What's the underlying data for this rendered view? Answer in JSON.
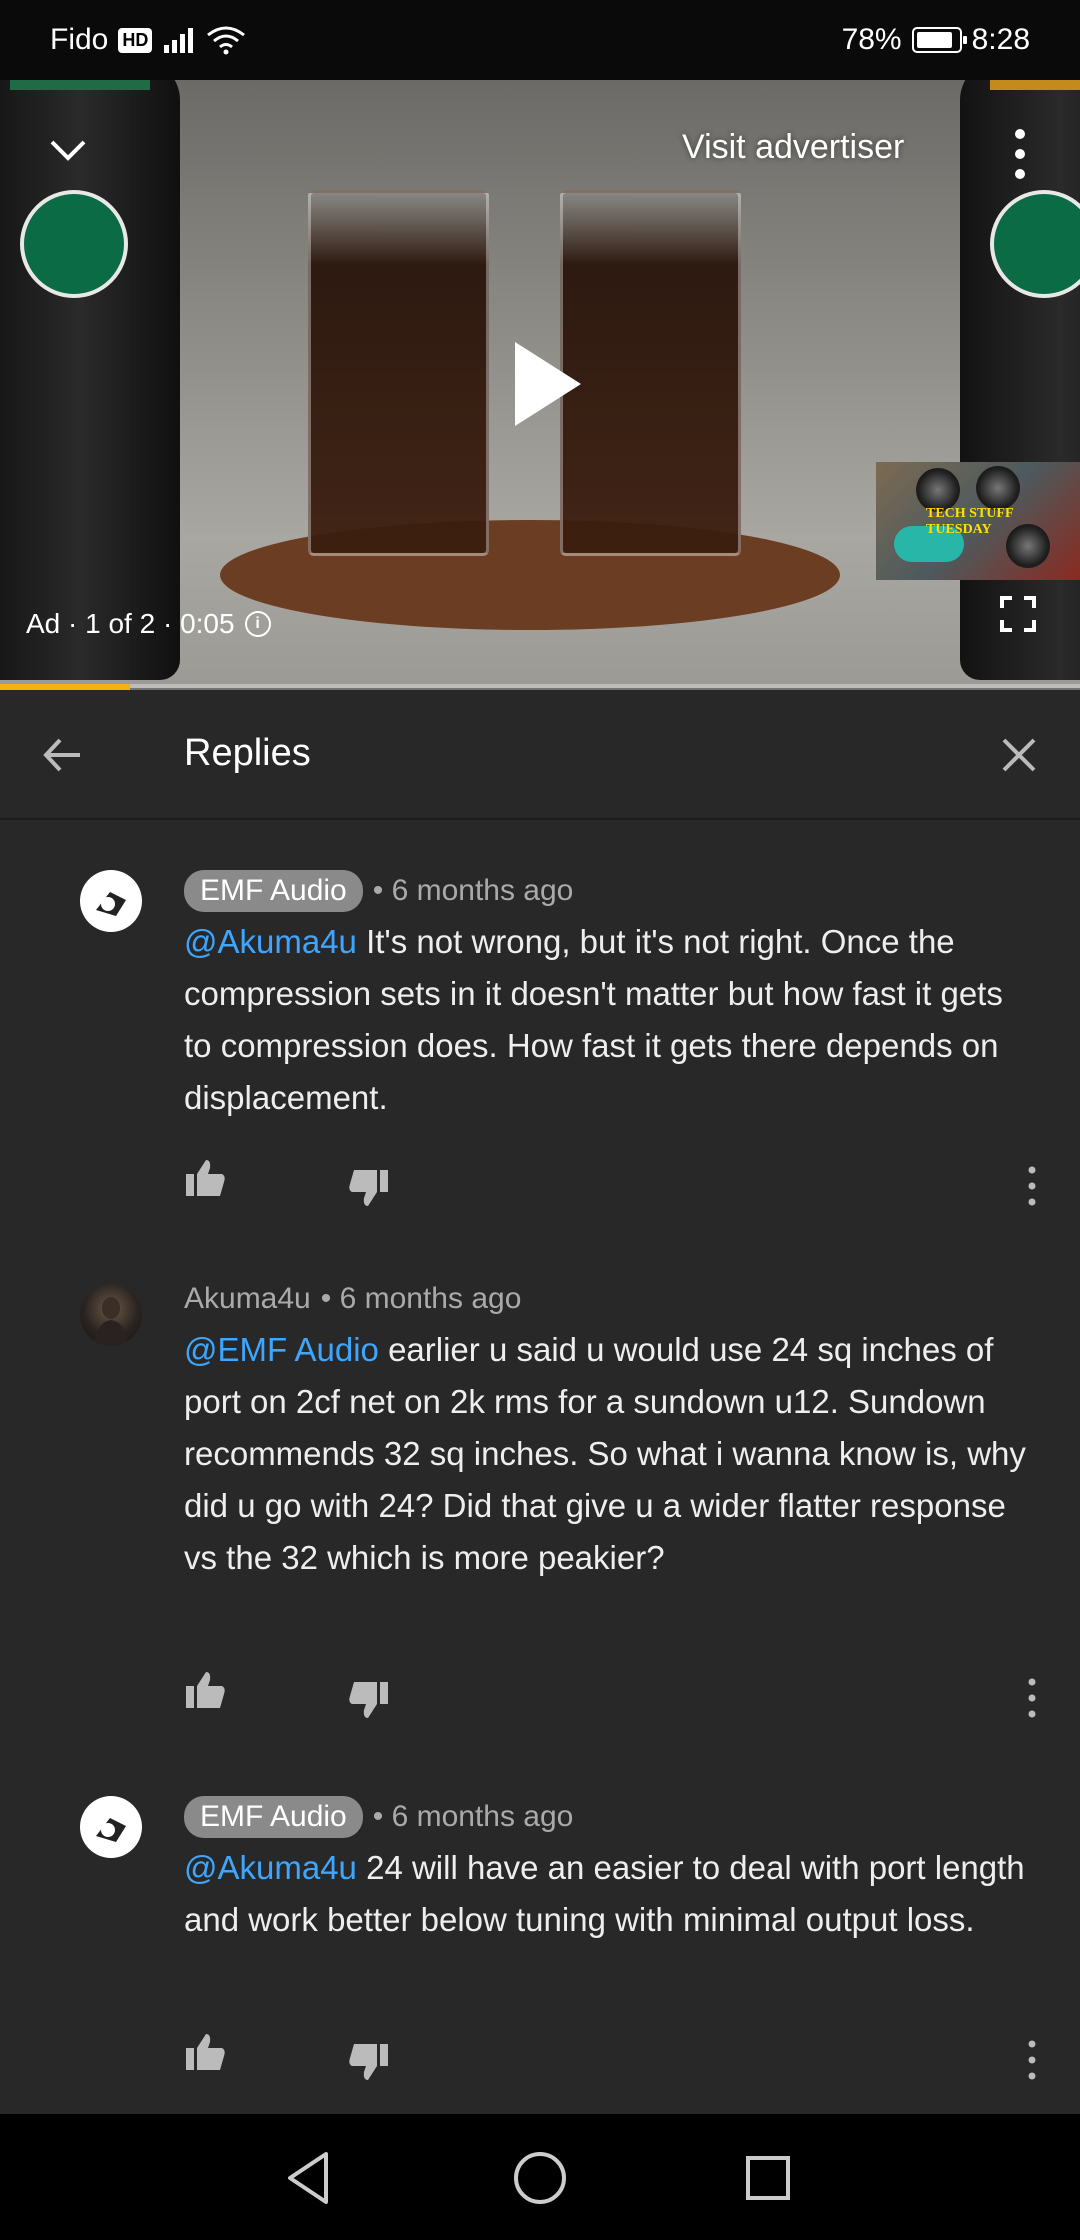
{
  "status_bar": {
    "carrier": "Fido",
    "hd_badge": "HD",
    "battery": "78%",
    "time": "8:28"
  },
  "video": {
    "visit_advertiser": "Visit advertiser",
    "ad_info": "Ad · 1 of 2 · 0:05",
    "info_icon": "ⓘ",
    "progress": 0.12,
    "thumbnail_text": "TECH STUFF TUESDAY"
  },
  "replies_header": {
    "title": "Replies"
  },
  "comments": [
    {
      "author": "EMF Audio",
      "is_creator": true,
      "time": "• 6 months ago",
      "mention": "@Akuma4u",
      "text": " It's not wrong, but it's not right. Once the compression sets in it doesn't matter but how fast it gets to compression does. How fast it gets there depends on displacement."
    },
    {
      "author": "Akuma4u",
      "is_creator": false,
      "time": "• 6 months ago",
      "mention": "@EMF Audio",
      "text": " earlier u said u would use 24 sq inches of port on 2cf net on 2k rms for a sundown u12. Sundown recommends 32 sq inches. So what i wanna know is, why did u go with 24? Did that give u a wider flatter response vs the 32 which is more peakier?"
    },
    {
      "author": "EMF Audio",
      "is_creator": true,
      "time": "• 6 months ago",
      "mention": "@Akuma4u",
      "text": " 24 will have an easier to deal with port length and work better below tuning with minimal output loss."
    }
  ],
  "icons": {
    "collapse": "chevron-down-icon",
    "more": "more-vertical-icon",
    "fullscreen": "fullscreen-icon",
    "back": "arrow-left-icon",
    "close": "close-icon",
    "like": "thumbs-up-icon",
    "dislike": "thumbs-down-icon",
    "nav_back": "triangle-back-icon",
    "nav_home": "circle-home-icon",
    "nav_recent": "square-recents-icon"
  },
  "colors": {
    "background": "#282828",
    "mention": "#3ea6ff",
    "progress": "#f2b310",
    "creator_chip": "#8a8a8a"
  }
}
